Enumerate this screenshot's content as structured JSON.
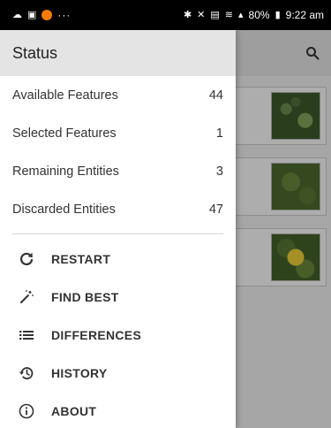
{
  "status_bar": {
    "left_dots": "···",
    "battery_percent": "80%",
    "time": "9:22 am"
  },
  "drawer": {
    "title": "Status",
    "stats": [
      {
        "label": "Available Features",
        "value": "44"
      },
      {
        "label": "Selected Features",
        "value": "1"
      },
      {
        "label": "Remaining Entities",
        "value": "3"
      },
      {
        "label": "Discarded Entities",
        "value": "47"
      }
    ],
    "menu": [
      {
        "label": "RESTART",
        "icon": "refresh-icon"
      },
      {
        "label": "FIND BEST",
        "icon": "magic-wand-icon"
      },
      {
        "label": "DIFFERENCES",
        "icon": "list-icon"
      },
      {
        "label": "HISTORY",
        "icon": "history-icon"
      },
      {
        "label": "ABOUT",
        "icon": "info-icon"
      }
    ]
  },
  "colors": {
    "drawer_header_bg": "#e4e4e4",
    "status_bar_bg": "#000000",
    "app_bar_bg": "#e9e9e9",
    "notification_orange": "#f57c00",
    "flower_yellow": "#f2d43a"
  }
}
